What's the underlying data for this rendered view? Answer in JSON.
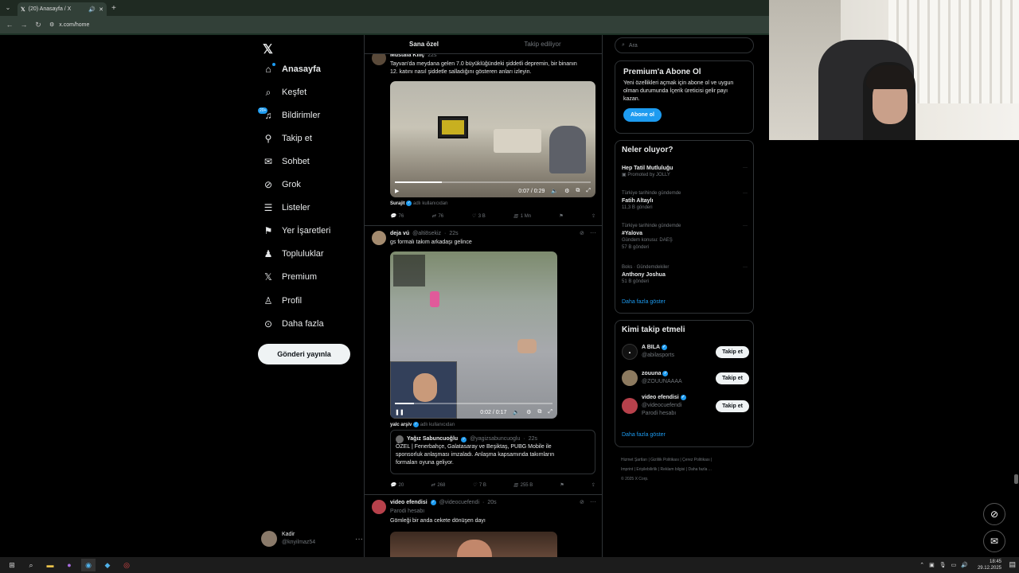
{
  "browser": {
    "tab_title": "(20) Anasayfa / X",
    "url": "x.com/home"
  },
  "nav": {
    "items": [
      {
        "label": "Anasayfa",
        "icon": "home-icon"
      },
      {
        "label": "Keşfet",
        "icon": "search-icon"
      },
      {
        "label": "Bildirimler",
        "icon": "bell-icon",
        "badge": "20+"
      },
      {
        "label": "Takip et",
        "icon": "person-add-icon"
      },
      {
        "label": "Sohbet",
        "icon": "mail-icon"
      },
      {
        "label": "Grok",
        "icon": "grok-icon"
      },
      {
        "label": "Listeler",
        "icon": "list-icon"
      },
      {
        "label": "Yer İşaretleri",
        "icon": "bookmark-icon"
      },
      {
        "label": "Topluluklar",
        "icon": "communities-icon"
      },
      {
        "label": "Premium",
        "icon": "x-premium-icon"
      },
      {
        "label": "Profil",
        "icon": "profile-icon"
      },
      {
        "label": "Daha fazla",
        "icon": "more-circle-icon"
      }
    ],
    "post_button": "Gönderi yayınla",
    "profile": {
      "name": "Kadir",
      "handle": "@knyilmaz54"
    }
  },
  "feed": {
    "tabs": [
      "Sana özel",
      "Takip ediliyor"
    ],
    "post1": {
      "name": "Mustafa Kılıç",
      "time": "22s",
      "text_line1": "Tayvan'da meydana gelen 7.0 büyüklüğündeki şiddetli depremin, bir binanın",
      "text_line2": "12. katını nasıl şiddetle salladığını gösteren anları izleyin.",
      "video_time": "0:07 / 0:29",
      "video_progress": 0.24,
      "via_name": "Surajit",
      "via_suffix": "adlı kullanıcıdan",
      "replies": "76",
      "reposts": "76",
      "likes": "3 B",
      "views": "1 Mn"
    },
    "post2": {
      "name": "deja vú",
      "handle": "@alti8sekiz",
      "time": "22s",
      "text": "gs formalı takım arkadaşı gelince",
      "video_time": "0:02 / 0:17",
      "video_progress": 0.12,
      "via_name": "yalc arşiv",
      "via_suffix": "adlı kullanıcıdan",
      "quote_name": "Yağız Sabuncuoğlu",
      "quote_handle": "@yagizsabuncuoglu",
      "quote_time": "22s",
      "quote_line1": "ÖZEL | Fenerbahçe, Galatasaray ve Beşiktaş, PUBG Mobile ile",
      "quote_line2": "sponsorluk anlaşması imzaladı. Anlaşma kapsamında takımların",
      "quote_line3": "formaları oyuna geliyor.",
      "replies": "20",
      "reposts": "268",
      "likes": "7 B",
      "views": "255 B"
    },
    "post3": {
      "name": "video efendisi",
      "handle": "@videocuefendi",
      "time": "20s",
      "label": "Parodi hesabı",
      "text": "Gömleği bir anda cekete dönüşen dayı"
    }
  },
  "right": {
    "search_placeholder": "Ara",
    "premium": {
      "title": "Premium'a Abone Ol",
      "line1": "Yeni özellikleri açmak için abone ol ve uygun",
      "line2": "olman durumunda İçerik üreticisi gelir payı",
      "line3": "kazan.",
      "button": "Abone ol"
    },
    "trends_title": "Neler oluyor?",
    "trends": [
      {
        "context": "",
        "title": "Hep Tatil Mutluluğu",
        "meta": "Promoted by JOLLY"
      },
      {
        "context": "Türkiye tarihinde gündemde",
        "title": "Fatih Altaylı",
        "meta": "11,3 B gönderi"
      },
      {
        "context": "Türkiye tarihinde gündemde",
        "title": "#Yalova",
        "meta": "Gündem konusu: DAEŞ",
        "meta2": "57 B gönderi"
      },
      {
        "context": "Boks · Gündemdekiler",
        "title": "Anthony Joshua",
        "meta": "51 B gönderi"
      }
    ],
    "show_more": "Daha fazla göster",
    "who_title": "Kimi takip etmeli",
    "who": [
      {
        "name": "A BILA",
        "handle": "@abilasports",
        "button": "Takip et"
      },
      {
        "name": "zouuna",
        "handle": "@ZOUUNAAAA",
        "button": "Takip et"
      },
      {
        "name": "video efendisi",
        "handle": "@videocuefendi",
        "extra": "Parodi hesabı",
        "button": "Takip et"
      }
    ],
    "footer_line1": "Hizmet Şartları | Gizlilik Politikası | Çerez Politikası |",
    "footer_line2": "Imprint | Erişilebilirlik | Reklam bilgisi | Daha fazla ...",
    "footer_line3": "© 2025 X Corp."
  },
  "taskbar": {
    "time": "18:45",
    "date": "29.12.2025"
  },
  "colors": {
    "accent": "#1d9bf0",
    "bg": "#000000",
    "border": "#2f3336"
  }
}
